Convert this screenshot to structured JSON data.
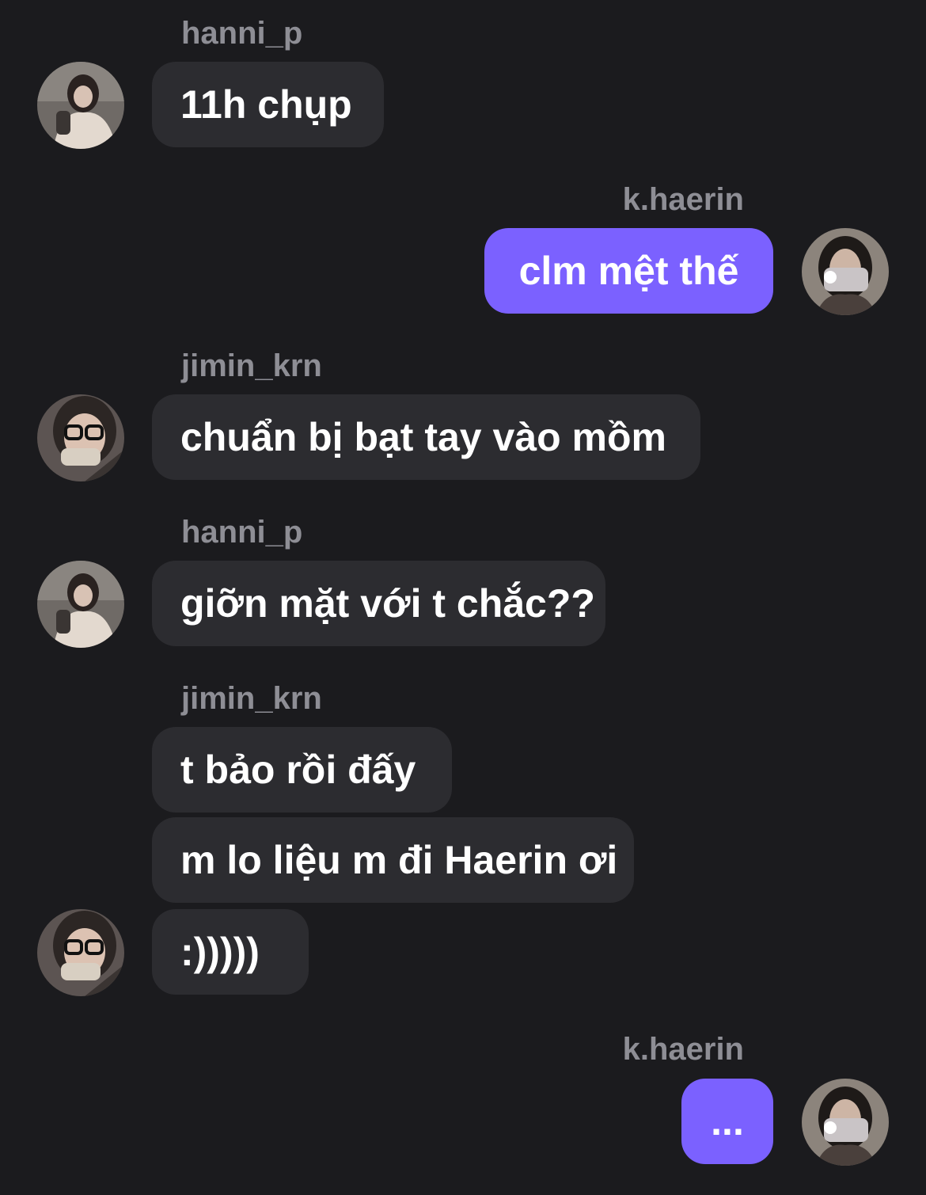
{
  "messages": [
    {
      "sender": "hanni_p",
      "text": "11h chụp"
    },
    {
      "sender": "k.haerin",
      "text": "clm mệt thế"
    },
    {
      "sender": "jimin_krn",
      "text": "chuẩn bị bạt tay vào mồm"
    },
    {
      "sender": "hanni_p",
      "text": "giỡn mặt với t chắc??"
    },
    {
      "sender": "jimin_krn",
      "text": "t bảo rồi đấy"
    },
    {
      "sender": "jimin_krn",
      "text": "m lo liệu m đi Haerin ơi"
    },
    {
      "sender": "jimin_krn",
      "text": ":)))))"
    },
    {
      "sender": "k.haerin",
      "text": "..."
    }
  ],
  "colors": {
    "background": "#1b1b1e",
    "incoming_bubble": "#2c2c30",
    "outgoing_bubble": "#7b61ff",
    "sender_name": "#8e8e95"
  }
}
